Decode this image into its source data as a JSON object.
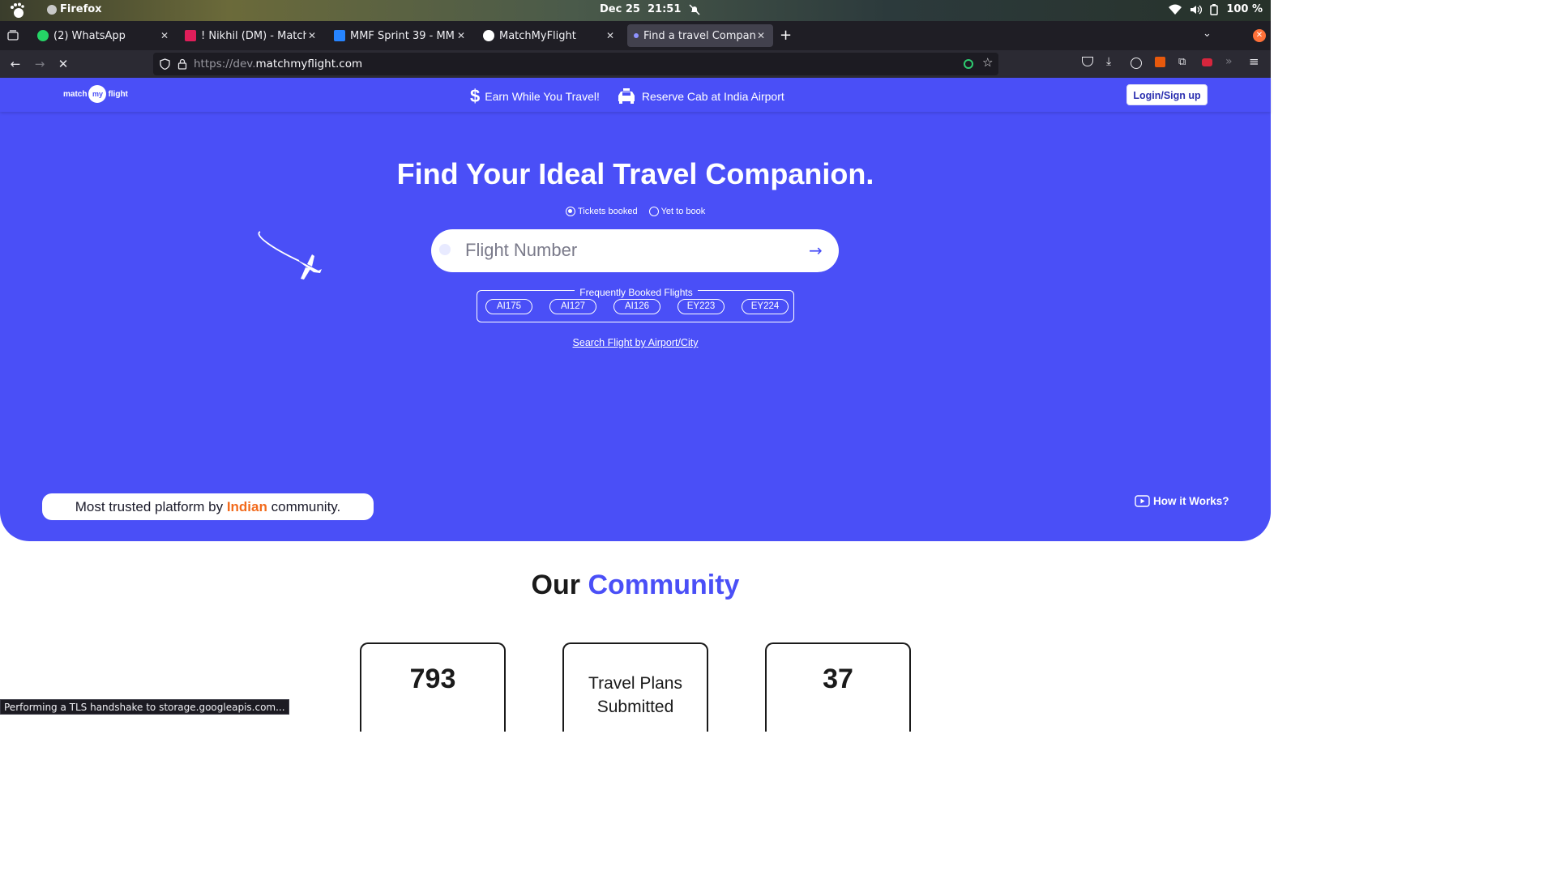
{
  "system": {
    "app_name": "Firefox",
    "clock": "Dec 25  21:51",
    "battery": "100 %"
  },
  "tabs": [
    {
      "title": "(2) WhatsApp",
      "favicon": "whatsapp-icon",
      "color": "#25d366"
    },
    {
      "title": "! Nikhil (DM) - MatchMyFlight",
      "favicon": "slack-icon",
      "color": "#e01e5a"
    },
    {
      "title": "MMF Sprint 39 - MMF board",
      "favicon": "jira-icon",
      "color": "#2684ff"
    },
    {
      "title": "MatchMyFlight",
      "favicon": "github-icon",
      "color": "#ffffff"
    },
    {
      "title": "Find a travel Companion",
      "favicon": "loading-icon",
      "color": "#4a4ff7"
    }
  ],
  "navbar": {
    "url_prefix": "https://dev.",
    "url_domain": "matchmyflight.com"
  },
  "site": {
    "logo_left": "match",
    "logo_mid": "my",
    "logo_right": "flight",
    "nav_earn": "Earn While You Travel!",
    "nav_cab": "Reserve Cab at India Airport",
    "login": "Login/Sign up",
    "headline": "Find Your Ideal Travel Companion.",
    "radio_booked": "Tickets booked",
    "radio_yet": "Yet to book",
    "search_placeholder": "Flight Number",
    "freq_label": "Frequently Booked Flights",
    "flights": [
      "AI175",
      "AI127",
      "AI126",
      "EY223",
      "EY224"
    ],
    "airport_link": "Search Flight by Airport/City",
    "trusted_pre": "Most trusted platform by",
    "trusted_accent": "Indian",
    "trusted_post": "community.",
    "how_it_works": "How it Works?",
    "community_a": "Our",
    "community_b": "Community",
    "stat1_value": "793",
    "stat2_label": "Travel Plans Submitted",
    "stat3_value": "37"
  },
  "status_text": "Performing a TLS handshake to storage.googleapis.com...",
  "colors": {
    "brand": "#4a4ff7",
    "accent": "#f26a1b"
  }
}
